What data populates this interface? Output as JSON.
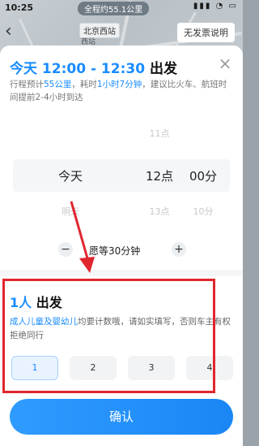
{
  "status_bar": {
    "time": "10:25",
    "trip_summary": "全程约55.1公里",
    "icons": [
      "signal-icon",
      "wifi-icon",
      "battery-icon"
    ]
  },
  "map_header": {
    "back_icon": "chevron-left-icon",
    "station": "北京西站",
    "station_sub": "西站",
    "no_invoice": "无发票说明"
  },
  "sheet": {
    "title_prefix": "今天 12:00 - 12:30",
    "title_suffix": " 出发",
    "close_icon": "close-icon",
    "info_part1": "行程预计",
    "info_distance": "55公里",
    "info_part2": "，耗时",
    "info_duration": "1小时7分钟",
    "info_part3": "，建议比火车、航班时间提前2-4小时到达"
  },
  "picker": {
    "above": {
      "hour": "11点"
    },
    "selected": {
      "day": "今天",
      "hour": "12点",
      "minute": "00分"
    },
    "below": {
      "day": "明天",
      "hour": "13点",
      "minute": "10分"
    }
  },
  "wait": {
    "minus": "−",
    "text": "愿等30分钟",
    "plus": "+"
  },
  "passengers": {
    "title_accent": "1人",
    "title_rest": " 出发",
    "note_accent": "成人儿童及婴幼儿",
    "note_rest": "均要计数哦，请如实填写，否则车主有权拒绝同行",
    "seats": [
      "1",
      "2",
      "3",
      "4"
    ],
    "selected_seat": "1"
  },
  "confirm_label": "确认",
  "colors": {
    "accent": "#1a8cff",
    "annotation": "#e0262e",
    "confirm_start": "#2f9bff",
    "confirm_end": "#1a86f5"
  }
}
